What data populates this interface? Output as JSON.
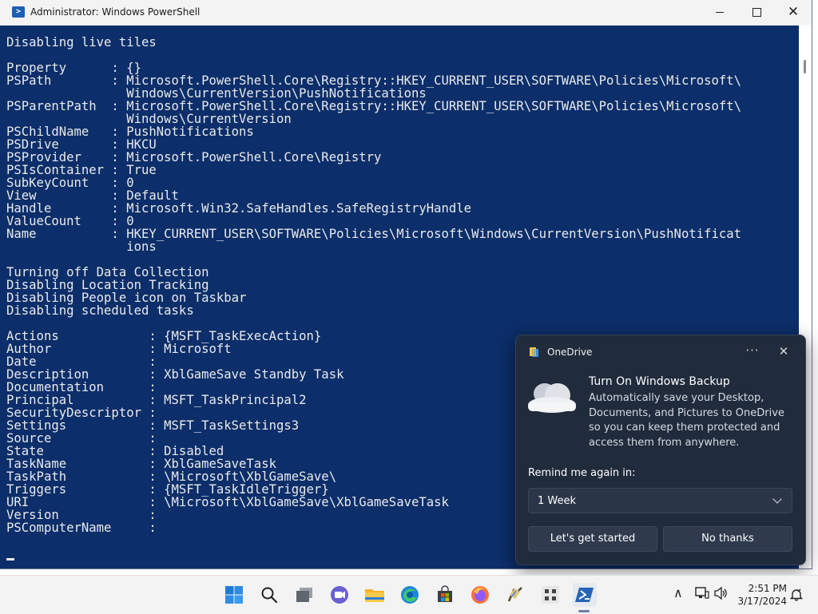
{
  "window": {
    "title": "Administrator: Windows PowerShell",
    "controls": {
      "minimize": "minimize",
      "maximize": "maximize",
      "close": "close"
    }
  },
  "console": {
    "lines": [
      "Disabling live tiles",
      "",
      "Property      : {}",
      "PSPath        : Microsoft.PowerShell.Core\\Registry::HKEY_CURRENT_USER\\SOFTWARE\\Policies\\Microsoft\\",
      "                Windows\\CurrentVersion\\PushNotifications",
      "PSParentPath  : Microsoft.PowerShell.Core\\Registry::HKEY_CURRENT_USER\\SOFTWARE\\Policies\\Microsoft\\",
      "                Windows\\CurrentVersion",
      "PSChildName   : PushNotifications",
      "PSDrive       : HKCU",
      "PSProvider    : Microsoft.PowerShell.Core\\Registry",
      "PSIsContainer : True",
      "SubKeyCount   : 0",
      "View          : Default",
      "Handle        : Microsoft.Win32.SafeHandles.SafeRegistryHandle",
      "ValueCount    : 0",
      "Name          : HKEY_CURRENT_USER\\SOFTWARE\\Policies\\Microsoft\\Windows\\CurrentVersion\\PushNotificat",
      "                ions",
      "",
      "Turning off Data Collection",
      "Disabling Location Tracking",
      "Disabling People icon on Taskbar",
      "Disabling scheduled tasks",
      "",
      "Actions            : {MSFT_TaskExecAction}",
      "Author             : Microsoft",
      "Date               :",
      "Description        : XblGameSave Standby Task",
      "Documentation      :",
      "Principal          : MSFT_TaskPrincipal2",
      "SecurityDescriptor :",
      "Settings           : MSFT_TaskSettings3",
      "Source             :",
      "State              : Disabled",
      "TaskName           : XblGameSaveTask",
      "TaskPath           : \\Microsoft\\XblGameSave\\",
      "Triggers           : {MSFT_TaskIdleTrigger}",
      "URI                : \\Microsoft\\XblGameSave\\XblGameSaveTask",
      "Version            :",
      "PSComputerName     :"
    ]
  },
  "toast": {
    "app_name": "OneDrive",
    "more_icon": "more-options-icon",
    "close_icon": "close-icon",
    "heading": "Turn On Windows Backup",
    "body": "Automatically save your Desktop, Documents, and Pictures to OneDrive so you can keep them protected and access them from anywhere.",
    "remind_label": "Remind me again in:",
    "remind_value": "1 Week",
    "primary_button": "Let's get started",
    "secondary_button": "No thanks"
  },
  "taskbar": {
    "apps": [
      "start-icon",
      "search-icon",
      "task-view-icon",
      "teams-chat-icon",
      "file-explorer-icon",
      "edge-icon",
      "microsoft-store-icon",
      "firefox-icon",
      "app-icon",
      "app-grid-icon",
      "powershell-icon"
    ],
    "tray": {
      "chevron": "∧",
      "time": "2:51 PM",
      "date": "3/17/2024"
    }
  },
  "colors": {
    "console_bg": "#0c2e6a",
    "console_fg": "#eaeaea",
    "toast_bg": "#202b3c"
  }
}
